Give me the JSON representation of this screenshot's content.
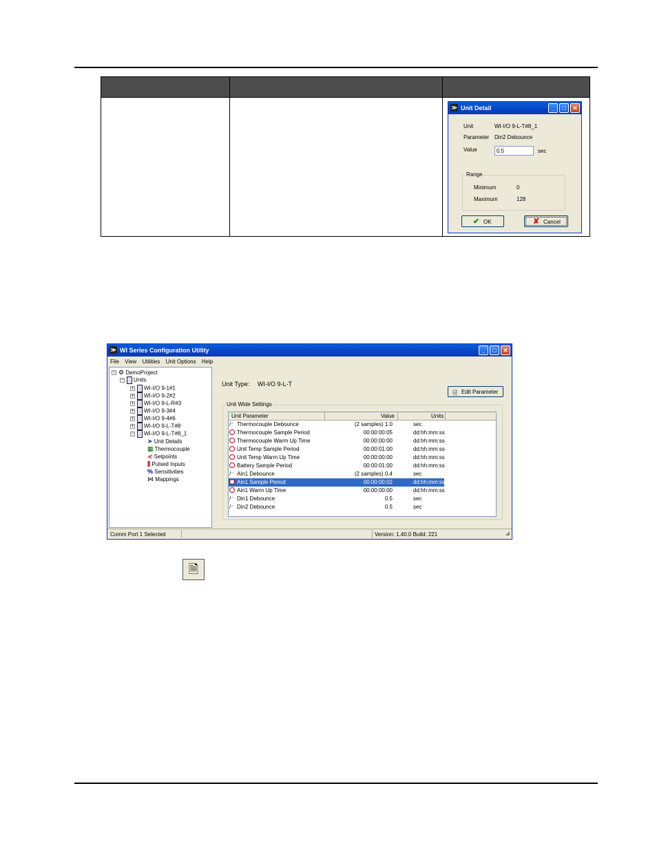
{
  "dialog": {
    "title": "Unit Detail",
    "unit_label": "Unit",
    "unit_value": "WI-I/O 9-L-T#8_1",
    "parameter_label": "Parameter",
    "parameter_value": "Din2 Debounce",
    "value_label": "Value",
    "value_input": "0.5",
    "value_unit": "sec",
    "range_title": "Range",
    "minimum_label": "Minimum",
    "minimum_value": "0",
    "maximum_label": "Maximum",
    "maximum_value": "128",
    "ok_label": "OK",
    "cancel_label": "Cancel"
  },
  "app": {
    "title": "WI Series Configuration Utility",
    "menu": [
      "File",
      "View",
      "Utilities",
      "Unit Options",
      "Help"
    ],
    "tree": {
      "root": "DemoProject",
      "units": "Units",
      "items": [
        "WI-I/O 9-1#1",
        "WI-I/O 9-2#2",
        "WI-I/O 9-L-R#3",
        "WI-I/O 9-3#4",
        "WI-I/O 9-4#6",
        "WI-I/O 9-L-T#8",
        "WI-I/O 9-L-T#8_1"
      ],
      "children": [
        "Unit Details",
        "Thermocouple",
        "Setpoints",
        "Pulsed Inputs",
        "Sensitivities",
        "Mappings"
      ]
    },
    "unit_type_label": "Unit Type:",
    "unit_type_value": "WI-I/O 9-L-T",
    "edit_parameter": "Edit Parameter",
    "group_title": "Unit Wide Settings",
    "columns": [
      "Unit Parameter",
      "Value",
      "Units"
    ],
    "rows": [
      {
        "icon": "debounce",
        "name": "Thermocouple Debounce",
        "value": "(2 samples)  1.0",
        "units": "sec"
      },
      {
        "icon": "clock",
        "name": "Thermocouple Sample Period",
        "value": "00:00:00:05",
        "units": "dd:hh:mm:ss"
      },
      {
        "icon": "clock",
        "name": "Thermocouple Warm Up Time",
        "value": "00:00:00:00",
        "units": "dd:hh:mm:ss"
      },
      {
        "icon": "clock",
        "name": "Unit Temp Sample Period",
        "value": "00:00:01:00",
        "units": "dd:hh:mm:ss"
      },
      {
        "icon": "clock",
        "name": "Unit Temp Warm Up Time",
        "value": "00:00:00:00",
        "units": "dd:hh:mm:ss"
      },
      {
        "icon": "clock",
        "name": "Battery Sample Period",
        "value": "00:00:01:00",
        "units": "dd:hh:mm:ss"
      },
      {
        "icon": "debounce",
        "name": "Ain1 Debounce",
        "value": "(2 samples)  0.4",
        "units": "sec"
      },
      {
        "icon": "clock",
        "name": "Ain1 Sample Period",
        "value": "00:00:00:02",
        "units": "dd:hh:mm:ss"
      },
      {
        "icon": "clock",
        "name": "Ain1 Warm Up Time",
        "value": "00:00:00:00",
        "units": "dd:hh:mm:ss"
      },
      {
        "icon": "debounce",
        "name": "Din1 Debounce",
        "value": "0.5",
        "units": "sec"
      },
      {
        "icon": "debounce",
        "name": "Din2 Debounce",
        "value": "0.5",
        "units": "sec"
      }
    ],
    "status_left": "Comm Port 1 Selected",
    "status_right": "Version: 1.40.0 Build: 221"
  }
}
